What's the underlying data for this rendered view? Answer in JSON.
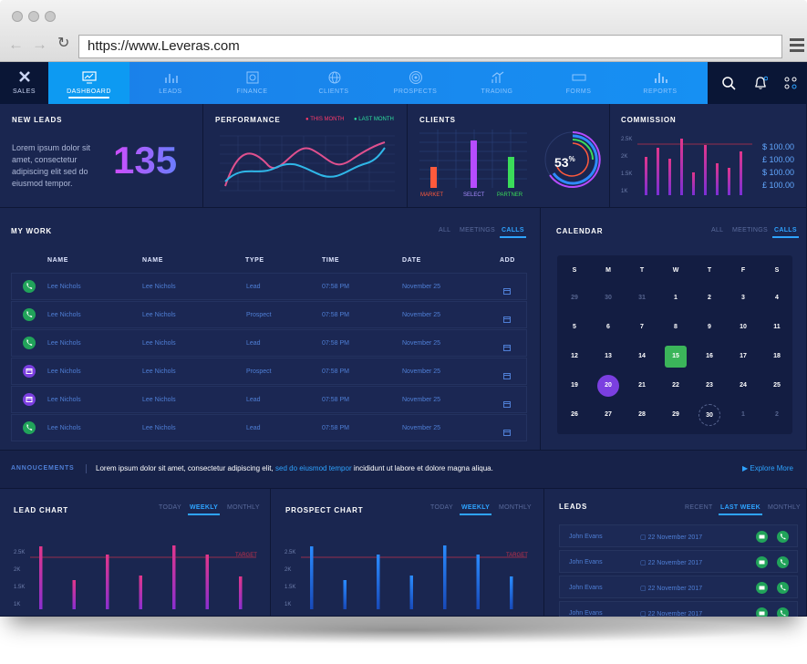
{
  "browser": {
    "url": "https://www.Leveras.com"
  },
  "brand": {
    "label": "SALES"
  },
  "nav": {
    "items": [
      {
        "label": "DASHBOARD",
        "icon": "monitor-icon",
        "active": true
      },
      {
        "label": "LEADS",
        "icon": "bar-chart-icon"
      },
      {
        "label": "FINANCE",
        "icon": "finance-icon"
      },
      {
        "label": "CLIENTS",
        "icon": "globe-icon"
      },
      {
        "label": "PROSPECTS",
        "icon": "target-icon"
      },
      {
        "label": "TRADING",
        "icon": "trading-icon"
      },
      {
        "label": "FORMS",
        "icon": "form-icon"
      },
      {
        "label": "REPORTS",
        "icon": "reports-icon"
      }
    ]
  },
  "new_leads": {
    "title": "NEW LEADS",
    "text": "Lorem ipsum dolor sit amet, consectetur adipiscing elit sed do eiusmod tempor.",
    "value": "135"
  },
  "performance": {
    "title": "PERFORMANCE",
    "legend": [
      "THIS MONTH",
      "LAST MONTH"
    ],
    "colors": [
      "#ff3a6b",
      "#2ee0a0"
    ]
  },
  "clients": {
    "title": "CLIENTS",
    "bars": [
      {
        "label": "MARKET",
        "value": 0.45,
        "color": "#ff5a3c"
      },
      {
        "label": "SELECT",
        "value": 1.0,
        "color": "#b64cff"
      },
      {
        "label": "PARTNER",
        "value": 0.65,
        "color": "#3bdc5a"
      }
    ],
    "percent": "53",
    "percent_sign": "%"
  },
  "commission": {
    "title": "COMMISSION",
    "yticks": [
      "2.5K",
      "2K",
      "1.5K",
      "1K"
    ],
    "values": [
      "$ 100.00",
      "£ 100.00",
      "$ 100.00",
      "£ 100.00"
    ]
  },
  "mywork": {
    "title": "MY WORK",
    "tabs": [
      "ALL",
      "MEETINGS",
      "CALLS"
    ],
    "columns": [
      "NAME",
      "NAME",
      "TYPE",
      "TIME",
      "DATE",
      "ADD"
    ],
    "rows": [
      {
        "n1": "Lee Nichols",
        "n2": "Lee Nichols",
        "type": "Lead",
        "time": "07:58 PM",
        "date": "November 25",
        "kind": "phone"
      },
      {
        "n1": "Lee Nichols",
        "n2": "Lee Nichols",
        "type": "Prospect",
        "time": "07:58 PM",
        "date": "November 25",
        "kind": "phone"
      },
      {
        "n1": "Lee Nichols",
        "n2": "Lee Nichols",
        "type": "Lead",
        "time": "07:58 PM",
        "date": "November 25",
        "kind": "phone"
      },
      {
        "n1": "Lee Nichols",
        "n2": "Lee Nichols",
        "type": "Prospect",
        "time": "07:58 PM",
        "date": "November 25",
        "kind": "calendar"
      },
      {
        "n1": "Lee Nichols",
        "n2": "Lee Nichols",
        "type": "Lead",
        "time": "07:58 PM",
        "date": "November 25",
        "kind": "calendar"
      },
      {
        "n1": "Lee Nichols",
        "n2": "Lee Nichols",
        "type": "Lead",
        "time": "07:58 PM",
        "date": "November 25",
        "kind": "phone"
      }
    ]
  },
  "calendar": {
    "title": "CALENDAR",
    "tabs": [
      "ALL",
      "MEETINGS",
      "CALLS"
    ],
    "days": [
      "S",
      "M",
      "T",
      "W",
      "T",
      "F",
      "S"
    ],
    "cells": [
      "29",
      "30",
      "31",
      "1",
      "2",
      "3",
      "4",
      "5",
      "6",
      "7",
      "8",
      "9",
      "10",
      "11",
      "12",
      "13",
      "14",
      "15",
      "16",
      "17",
      "18",
      "19",
      "20",
      "21",
      "22",
      "23",
      "24",
      "25",
      "26",
      "27",
      "28",
      "29",
      "30",
      "1",
      "2"
    ]
  },
  "announcements": {
    "label": "ANNOUCEMENTS",
    "text_a": "Lorem ipsum dolor sit amet, consectetur adipiscing elit,",
    "text_link": "sed do eiusmod tempor",
    "text_b": "incididunt ut labore et dolore magna aliqua.",
    "explore": "Explore More"
  },
  "lead_chart": {
    "title": "LEAD CHART",
    "tabs": [
      "TODAY",
      "WEEKLY",
      "MONTHLY"
    ],
    "yticks": [
      "2.5K",
      "2K",
      "1.5K",
      "1K"
    ],
    "target": "TARGET"
  },
  "prospect_chart": {
    "title": "PROSPECT CHART",
    "tabs": [
      "TODAY",
      "WEEKLY",
      "MONTHLY"
    ],
    "yticks": [
      "2.5K",
      "2K",
      "1.5K",
      "1K"
    ],
    "target": "TARGET"
  },
  "leads": {
    "title": "LEADS",
    "tabs": [
      "RECENT",
      "LAST WEEK",
      "MONTHLY"
    ],
    "rows": [
      {
        "name": "John Evans",
        "date": "22 November 2017"
      },
      {
        "name": "John Evans",
        "date": "22 November 2017"
      },
      {
        "name": "John Evans",
        "date": "22 November 2017"
      },
      {
        "name": "John Evans",
        "date": "22 November 2017"
      }
    ]
  }
}
